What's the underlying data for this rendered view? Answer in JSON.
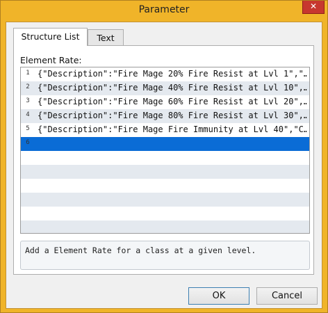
{
  "window": {
    "title": "Parameter",
    "close_glyph": "✕"
  },
  "tabs": [
    {
      "label": "Structure List",
      "active": true
    },
    {
      "label": "Text",
      "active": false
    }
  ],
  "panel": {
    "label": "Element Rate:",
    "rows": [
      {
        "num": "1",
        "text": "{\"Description\":\"Fire Mage 20% Fire Resist at Lvl 1\",\"…"
      },
      {
        "num": "2",
        "text": "{\"Description\":\"Fire Mage 40% Fire Resist at Lvl 10\",…"
      },
      {
        "num": "3",
        "text": "{\"Description\":\"Fire Mage 60% Fire Resist at Lvl 20\",…"
      },
      {
        "num": "4",
        "text": "{\"Description\":\"Fire Mage 80% Fire Resist at Lvl 30\",…"
      },
      {
        "num": "5",
        "text": "{\"Description\":\"Fire Mage Fire Immunity at Lvl 40\",\"C…"
      },
      {
        "num": "6",
        "text": ""
      }
    ],
    "selected_row": 6,
    "description": "Add a Element Rate for a class at a given level."
  },
  "buttons": {
    "ok": "OK",
    "cancel": "Cancel"
  },
  "colors": {
    "title_bar": "#f0b429",
    "selection": "#0a6cd6",
    "close_button": "#c7372f"
  }
}
